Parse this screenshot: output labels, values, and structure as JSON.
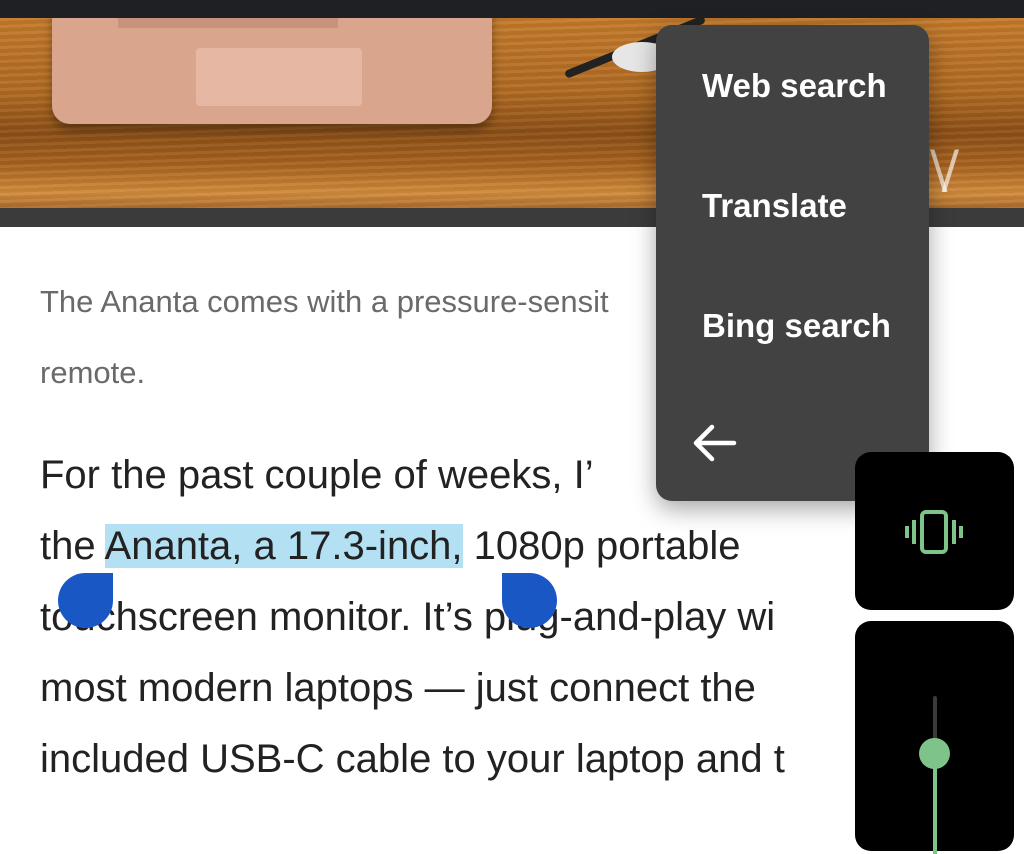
{
  "article": {
    "caption_line1": "The Ananta comes with a pressure-sensit",
    "caption_line2": "remote.",
    "para_line1": "For the past couple of weeks, I’",
    "para_line2_pre": "the ",
    "para_line2_sel": "Ananta, a 17.3-inch,",
    "para_line2_post": " 1080p portable",
    "para_line3": "touchscreen monitor. It’s plug-and-play wi",
    "para_line4": "most modern laptops — just connect the",
    "para_line5": "included USB-C cable to your laptop and t"
  },
  "context_menu": {
    "items": [
      "Web search",
      "Translate",
      "Bing search"
    ],
    "back_icon": "arrow-left-icon"
  },
  "volume_panel": {
    "ringer_mode_icon": "vibrate-icon",
    "level": 0.62,
    "accent_color": "#7ec48a"
  },
  "selection": {
    "highlight_color": "#b3e0f2",
    "handle_color": "#1958c4"
  }
}
